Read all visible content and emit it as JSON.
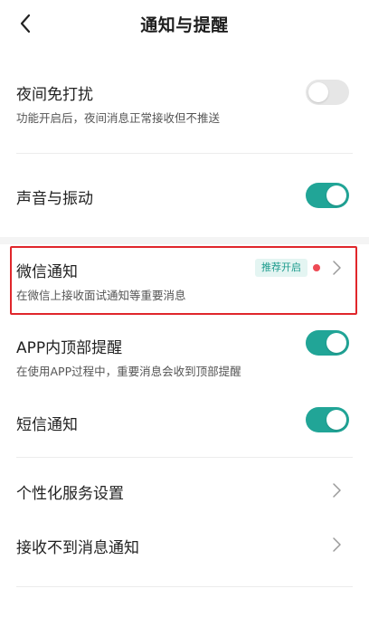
{
  "header": {
    "title": "通知与提醒"
  },
  "settings": {
    "night_dnd": {
      "title": "夜间免打扰",
      "description": "功能开启后，夜间消息正常接收但不推送",
      "enabled": false
    },
    "sound_vibration": {
      "title": "声音与振动",
      "enabled": true
    },
    "wechat_notify": {
      "title": "微信通知",
      "description": "在微信上接收面试通知等重要消息",
      "badge": "推荐开启"
    },
    "in_app_banner": {
      "title": "APP内顶部提醒",
      "description": "在使用APP过程中，重要消息会收到顶部提醒",
      "enabled": true
    },
    "sms_notify": {
      "title": "短信通知",
      "enabled": true
    },
    "personalized_service": {
      "title": "个性化服务设置"
    },
    "not_receiving_help": {
      "title": "接收不到消息通知"
    }
  },
  "colors": {
    "toggle_on": "#21a597",
    "toggle_off": "#e6e6e6",
    "highlight_border": "#e0262b",
    "badge_text": "#1d9b8d",
    "badge_bg": "#e4f5f2",
    "red_dot": "#ee4a55"
  }
}
